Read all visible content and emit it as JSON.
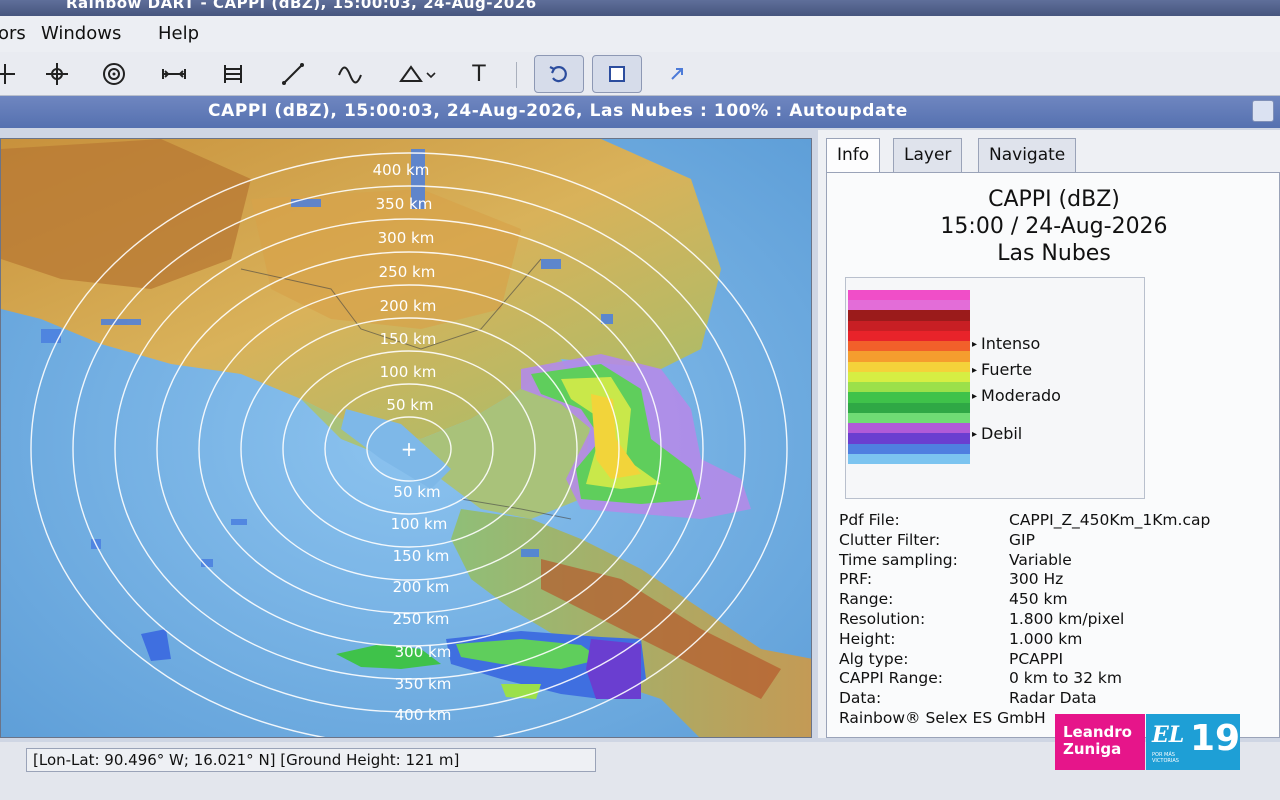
{
  "window_title": "Rainbow DART - CAPPI (dBZ), 15:00:03, 24-Aug-2026",
  "menu": [
    {
      "label": "ors"
    },
    {
      "label": "Windows"
    },
    {
      "label": "Help"
    }
  ],
  "toolbar": {
    "icons": [
      "pan-icon",
      "center-icon",
      "target-icon",
      "measure-distance-icon",
      "grid-icon",
      "zoom-line-icon",
      "wave-icon",
      "triangle-dropdown-icon",
      "text-icon",
      "undo-icon",
      "window-icon",
      "fullscreen-icon"
    ],
    "text_tool_label": "T"
  },
  "document": {
    "title": "CAPPI (dBZ), 15:00:03, 24-Aug-2026, Las Nubes : 100% : Autoupdate"
  },
  "map": {
    "center_marker": "+",
    "range_labels_north": [
      "400 km",
      "350 km",
      "300 km",
      "250 km",
      "200 km",
      "150 km",
      "100 km",
      "50 km"
    ],
    "range_labels_south": [
      "50 km",
      "100 km",
      "150 km",
      "200 km",
      "250 km",
      "300 km",
      "350 km",
      "400 km"
    ]
  },
  "panel": {
    "tabs": [
      {
        "label": "Info",
        "active": true
      },
      {
        "label": "Layer",
        "active": false
      },
      {
        "label": "Navigate",
        "active": false
      }
    ],
    "product": "CAPPI (dBZ)",
    "datetime": "15:00 / 24-Aug-2026",
    "site": "Las Nubes",
    "legend": {
      "colors": [
        "#f04ec8",
        "#e36dd8",
        "#9b1b1b",
        "#c81f24",
        "#e8232a",
        "#f2602a",
        "#f59d2e",
        "#f4d23a",
        "#d6ee43",
        "#9be04a",
        "#3fc24a",
        "#2fa845",
        "#6fdc74",
        "#b05ad8",
        "#6a3ed0",
        "#4f7fe0",
        "#7cc4f0"
      ],
      "labels": [
        "Intenso",
        "Fuerte",
        "Moderado",
        "Debil"
      ]
    },
    "info": [
      {
        "key": "Pdf File:",
        "value": "CAPPI_Z_450Km_1Km.cap"
      },
      {
        "key": "Clutter Filter:",
        "value": "GIP"
      },
      {
        "key": "Time sampling:",
        "value": "Variable"
      },
      {
        "key": "PRF:",
        "value": "300 Hz"
      },
      {
        "key": "Range:",
        "value": "450 km"
      },
      {
        "key": "Resolution:",
        "value": "1.800 km/pixel"
      },
      {
        "key": "Height:",
        "value": "1.000 km"
      },
      {
        "key": "Alg type:",
        "value": "PCAPPI"
      },
      {
        "key": "CAPPI Range:",
        "value": "0 km to 32 km"
      },
      {
        "key": "Data:",
        "value": "Radar Data"
      }
    ],
    "footer": "Rainbow® Selex ES GmbH"
  },
  "status": {
    "text": "[Lon-Lat: 90.496° W; 16.021° N] [Ground Height: 121 m]"
  },
  "watermark": {
    "name": "Leandro Zuniga",
    "channel_prefix": "EL",
    "channel_number": "19",
    "slogan": "POR MÁS VICTORIAS"
  }
}
